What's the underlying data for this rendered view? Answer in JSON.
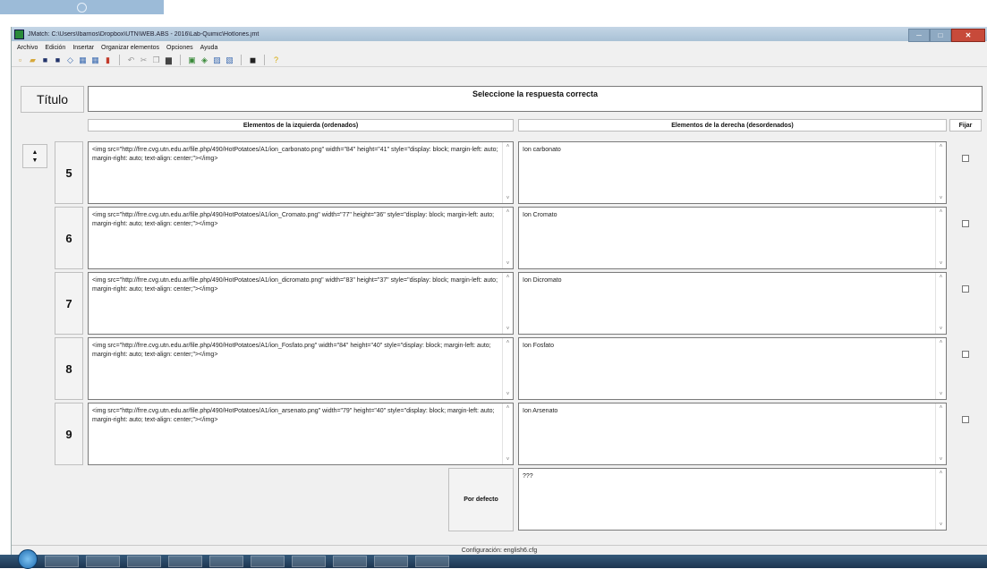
{
  "window": {
    "title": "JMatch: C:\\Users\\Ibarrios\\Dropbox\\UTN\\WEB.ABS - 2016\\Lab-Quimic\\HotIones.jmt",
    "minimize_glyph": "─",
    "maximize_glyph": "□",
    "close_glyph": "✕"
  },
  "menu": [
    "Archivo",
    "Edición",
    "Insertar",
    "Organizar elementos",
    "Opciones",
    "Ayuda"
  ],
  "toolbar": {
    "icons": [
      {
        "name": "new-file-icon",
        "glyph": "▫",
        "color": "#c89a3a"
      },
      {
        "name": "open-folder-icon",
        "glyph": "▰",
        "color": "#d6a83a"
      },
      {
        "name": "save-icon",
        "glyph": "■",
        "color": "#22336a"
      },
      {
        "name": "save-as-icon",
        "glyph": "■",
        "color": "#22336a"
      },
      {
        "name": "export-icon",
        "glyph": "◇",
        "color": "#3a6ab0"
      },
      {
        "name": "web-export-icon",
        "glyph": "▦",
        "color": "#3a6ab0"
      },
      {
        "name": "add-exercise-icon",
        "glyph": "▦",
        "color": "#3a6ab0"
      },
      {
        "name": "exit-icon",
        "glyph": "▮",
        "color": "#c23a2a"
      },
      {
        "name": "undo-icon",
        "glyph": "↶",
        "color": "#9a9a9a"
      },
      {
        "name": "cut-icon",
        "glyph": "✂",
        "color": "#9a9a9a"
      },
      {
        "name": "copy-icon",
        "glyph": "❐",
        "color": "#9a9a9a"
      },
      {
        "name": "paste-icon",
        "glyph": "▆",
        "color": "#444444"
      },
      {
        "name": "image-icon",
        "glyph": "▣",
        "color": "#3a8a3a"
      },
      {
        "name": "link-icon",
        "glyph": "◈",
        "color": "#3a8a3a"
      },
      {
        "name": "text-icon",
        "glyph": "▨",
        "color": "#3a6ab0"
      },
      {
        "name": "options-icon",
        "glyph": "▧",
        "color": "#3a6ab0"
      },
      {
        "name": "preview-icon",
        "glyph": "◼",
        "color": "#222222"
      },
      {
        "name": "help-icon",
        "glyph": "?",
        "color": "#d6a800"
      }
    ]
  },
  "title_label": "Título",
  "title_value": "Seleccione la respuesta correcta",
  "headers": {
    "left": "Elementos de la izquierda (ordenados)",
    "right": "Elementos de la derecha (desordenados)",
    "fix": "Fijar"
  },
  "spin": {
    "up": "▲",
    "down": "▼"
  },
  "scroll": {
    "up": "˄",
    "down": "˅"
  },
  "rows": [
    {
      "number": "5",
      "left": "<img src=\"http://frre.cvg.utn.edu.ar/file.php/490/HotPotatoes/A1/ion_carbonato.png\" width=\"84\" height=\"41\" style=\"display: block; margin-left: auto; margin-right: auto; text-align: center;\"></img>",
      "right": "Ion carbonato"
    },
    {
      "number": "6",
      "left": "<img src=\"http://frre.cvg.utn.edu.ar/file.php/490/HotPotatoes/A1/ion_Cromato.png\" width=\"77\" height=\"36\" style=\"display: block; margin-left: auto; margin-right: auto; text-align: center;\"></img>",
      "right": "Ion Cromato"
    },
    {
      "number": "7",
      "left": "<img src=\"http://frre.cvg.utn.edu.ar/file.php/490/HotPotatoes/A1/ion_dicromato.png\" width=\"83\" height=\"37\" style=\"display: block; margin-left: auto; margin-right: auto; text-align: center;\"></img>",
      "right": "Ion Dicromato"
    },
    {
      "number": "8",
      "left": "<img src=\"http://frre.cvg.utn.edu.ar/file.php/490/HotPotatoes/A1/ion_Fosfato.png\" width=\"84\" height=\"40\" style=\"display: block; margin-left: auto; margin-right: auto; text-align: center;\"></img>",
      "right": "Ion Fosfato"
    },
    {
      "number": "9",
      "left": "<img src=\"http://frre.cvg.utn.edu.ar/file.php/490/HotPotatoes/A1/ion_arsenato.png\" width=\"79\" height=\"40\" style=\"display: block; margin-left: auto; margin-right: auto; text-align: center;\"></img>",
      "right": "Ion Arsenato"
    }
  ],
  "default_button": "Por defecto",
  "default_value": "???",
  "status": "Configuración: english6.cfg"
}
